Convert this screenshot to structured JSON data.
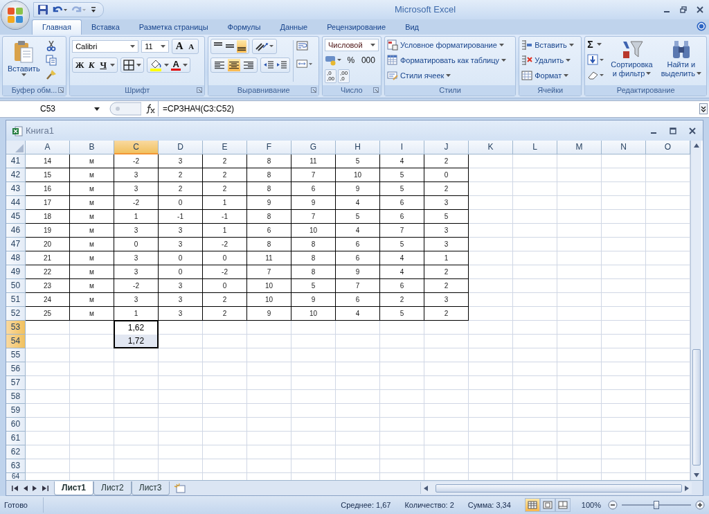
{
  "window": {
    "title": "Microsoft Excel",
    "undo_enabled": true,
    "redo_enabled": false
  },
  "tabs": [
    {
      "label": "Главная",
      "selected": true
    },
    {
      "label": "Вставка",
      "selected": false
    },
    {
      "label": "Разметка страницы",
      "selected": false
    },
    {
      "label": "Формулы",
      "selected": false
    },
    {
      "label": "Данные",
      "selected": false
    },
    {
      "label": "Рецензирование",
      "selected": false
    },
    {
      "label": "Вид",
      "selected": false
    }
  ],
  "ribbon": {
    "clipboard": {
      "label": "Буфер обм...",
      "paste": "Вставить"
    },
    "font": {
      "label": "Шрифт",
      "font_name": "Calibri",
      "font_size": "11",
      "grow": "A",
      "shrink": "A",
      "bold": "Ж",
      "italic": "К",
      "underline": "Ч",
      "font_color": "A"
    },
    "alignment": {
      "label": "Выравнивание",
      "vertical": [
        {
          "selected": false
        },
        {
          "selected": false
        },
        {
          "selected": true
        }
      ],
      "horizontal": [
        {
          "selected": false
        },
        {
          "selected": true
        },
        {
          "selected": false
        }
      ]
    },
    "number": {
      "label": "Число",
      "format": "Числовой",
      "percent": "%",
      "thousands": "000",
      "increase_decimal": [
        ",0",
        ",00"
      ],
      "decrease_decimal": [
        ",00",
        ",0"
      ]
    },
    "styles": {
      "label": "Стили",
      "commands": [
        {
          "kind": "conditional",
          "label": "Условное форматирование"
        },
        {
          "kind": "table",
          "label": "Форматировать как таблицу"
        },
        {
          "kind": "cellstyles",
          "label": "Стили ячеек"
        }
      ]
    },
    "cells": {
      "label": "Ячейки",
      "commands": [
        {
          "kind": "insert",
          "label": "Вставить"
        },
        {
          "kind": "delete",
          "label": "Удалить"
        },
        {
          "kind": "format",
          "label": "Формат"
        }
      ]
    },
    "editing": {
      "label": "Редактирование",
      "sum": "Σ",
      "sort": [
        "Сортировка",
        "и фильтр"
      ],
      "find": [
        "Найти и",
        "выделить"
      ]
    }
  },
  "formula_bar": {
    "name_box": "C53",
    "formula": "=СРЗНАЧ(C3:C52)"
  },
  "workbook": {
    "title": "Книга1",
    "columns": [
      {
        "label": "A",
        "selected": false
      },
      {
        "label": "B",
        "selected": false
      },
      {
        "label": "C",
        "selected": true
      },
      {
        "label": "D",
        "selected": false
      },
      {
        "label": "E",
        "selected": false
      },
      {
        "label": "F",
        "selected": false
      },
      {
        "label": "G",
        "selected": false
      },
      {
        "label": "H",
        "selected": false
      },
      {
        "label": "I",
        "selected": false
      },
      {
        "label": "J",
        "selected": false
      },
      {
        "label": "K",
        "selected": false
      },
      {
        "label": "L",
        "selected": false
      },
      {
        "label": "M",
        "selected": false
      },
      {
        "label": "N",
        "selected": false
      },
      {
        "label": "O",
        "selected": false
      }
    ],
    "rows": [
      {
        "number": "41",
        "kind": "table",
        "selected": false,
        "cells": [
          "14",
          "м",
          "-2",
          "3",
          "2",
          "8",
          "11",
          "5",
          "4",
          "2"
        ]
      },
      {
        "number": "42",
        "kind": "table",
        "selected": false,
        "cells": [
          "15",
          "м",
          "3",
          "2",
          "2",
          "8",
          "7",
          "10",
          "5",
          "0"
        ]
      },
      {
        "number": "43",
        "kind": "table",
        "selected": false,
        "cells": [
          "16",
          "м",
          "3",
          "2",
          "2",
          "8",
          "6",
          "9",
          "5",
          "2"
        ]
      },
      {
        "number": "44",
        "kind": "table",
        "selected": false,
        "cells": [
          "17",
          "м",
          "-2",
          "0",
          "1",
          "9",
          "9",
          "4",
          "6",
          "3"
        ]
      },
      {
        "number": "45",
        "kind": "table",
        "selected": false,
        "cells": [
          "18",
          "м",
          "1",
          "-1",
          "-1",
          "8",
          "7",
          "5",
          "6",
          "5"
        ]
      },
      {
        "number": "46",
        "kind": "table",
        "selected": false,
        "cells": [
          "19",
          "м",
          "3",
          "3",
          "1",
          "6",
          "10",
          "4",
          "7",
          "3"
        ]
      },
      {
        "number": "47",
        "kind": "table",
        "selected": false,
        "cells": [
          "20",
          "м",
          "0",
          "3",
          "-2",
          "8",
          "8",
          "6",
          "5",
          "3"
        ]
      },
      {
        "number": "48",
        "kind": "table",
        "selected": false,
        "cells": [
          "21",
          "м",
          "3",
          "0",
          "0",
          "11",
          "8",
          "6",
          "4",
          "1"
        ]
      },
      {
        "number": "49",
        "kind": "table",
        "selected": false,
        "cells": [
          "22",
          "м",
          "3",
          "0",
          "-2",
          "7",
          "8",
          "9",
          "4",
          "2"
        ]
      },
      {
        "number": "50",
        "kind": "table",
        "selected": false,
        "cells": [
          "23",
          "м",
          "-2",
          "3",
          "0",
          "10",
          "5",
          "7",
          "6",
          "2"
        ]
      },
      {
        "number": "51",
        "kind": "table",
        "selected": false,
        "cells": [
          "24",
          "м",
          "3",
          "3",
          "2",
          "10",
          "9",
          "6",
          "2",
          "3"
        ]
      },
      {
        "number": "52",
        "kind": "table",
        "selected": false,
        "cells": [
          "25",
          "м",
          "1",
          "3",
          "2",
          "9",
          "10",
          "4",
          "5",
          "2"
        ]
      },
      {
        "number": "53",
        "kind": "plain",
        "selected": true,
        "active": true,
        "cells": [
          null,
          null,
          "1,62"
        ]
      },
      {
        "number": "54",
        "kind": "plain",
        "selected": true,
        "active": false,
        "cells": [
          null,
          null,
          "1,72"
        ]
      },
      {
        "number": "55",
        "selected": false
      },
      {
        "number": "56",
        "selected": false
      },
      {
        "number": "57",
        "selected": false
      },
      {
        "number": "58",
        "selected": false
      },
      {
        "number": "59",
        "selected": false
      },
      {
        "number": "60",
        "selected": false
      },
      {
        "number": "61",
        "selected": false
      },
      {
        "number": "62",
        "selected": false
      },
      {
        "number": "63",
        "selected": false
      },
      {
        "number": "64",
        "selected": false
      }
    ],
    "sheets": [
      {
        "label": "Лист1",
        "selected": true
      },
      {
        "label": "Лист2",
        "selected": false
      },
      {
        "label": "Лист3",
        "selected": false
      }
    ]
  },
  "status_bar": {
    "state": "Готово",
    "average": "Среднее: 1,67",
    "count": "Количество: 2",
    "sum": "Сумма: 3,34",
    "views": [
      {
        "selected": true
      },
      {
        "selected": false
      },
      {
        "selected": false
      }
    ],
    "zoom": "100%",
    "zoom_slider": {
      "level": 0.5
    }
  }
}
